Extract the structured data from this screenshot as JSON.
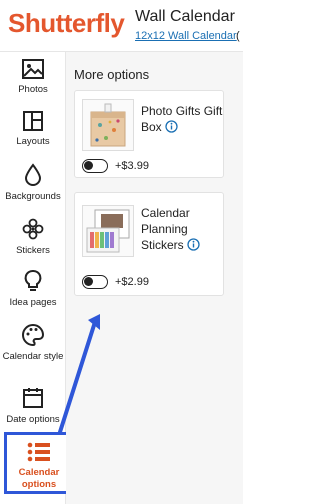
{
  "header": {
    "logo": "Shutterfly",
    "title": "Wall Calendar",
    "subtitle": "12x12 Wall Calendar",
    "paren": "("
  },
  "sidebar": {
    "items": [
      {
        "label": "Photos",
        "icon": "image-icon"
      },
      {
        "label": "Layouts",
        "icon": "layout-icon"
      },
      {
        "label": "Backgrounds",
        "icon": "droplet-icon"
      },
      {
        "label": "Stickers",
        "icon": "sticker-icon"
      },
      {
        "label": "Idea pages",
        "icon": "lightbulb-icon"
      },
      {
        "label": "Calendar style",
        "icon": "palette-icon"
      },
      {
        "label": "Date options",
        "icon": "calendar-icon"
      },
      {
        "label": "Calendar options",
        "icon": "list-icon"
      }
    ],
    "active": "Calendar options",
    "accent": "#d9501f",
    "highlight": "#2f57d8"
  },
  "panel": {
    "title": "More options",
    "options": [
      {
        "name": "Photo Gifts Gift Box",
        "price": "+$3.99",
        "enabled": false
      },
      {
        "name": "Calendar Planning Stickers",
        "price": "+$2.99",
        "enabled": false
      }
    ]
  },
  "colors": {
    "logo": "#e4572e",
    "link": "#1a6fb3",
    "annotation_arrow": "#2f57d8"
  }
}
